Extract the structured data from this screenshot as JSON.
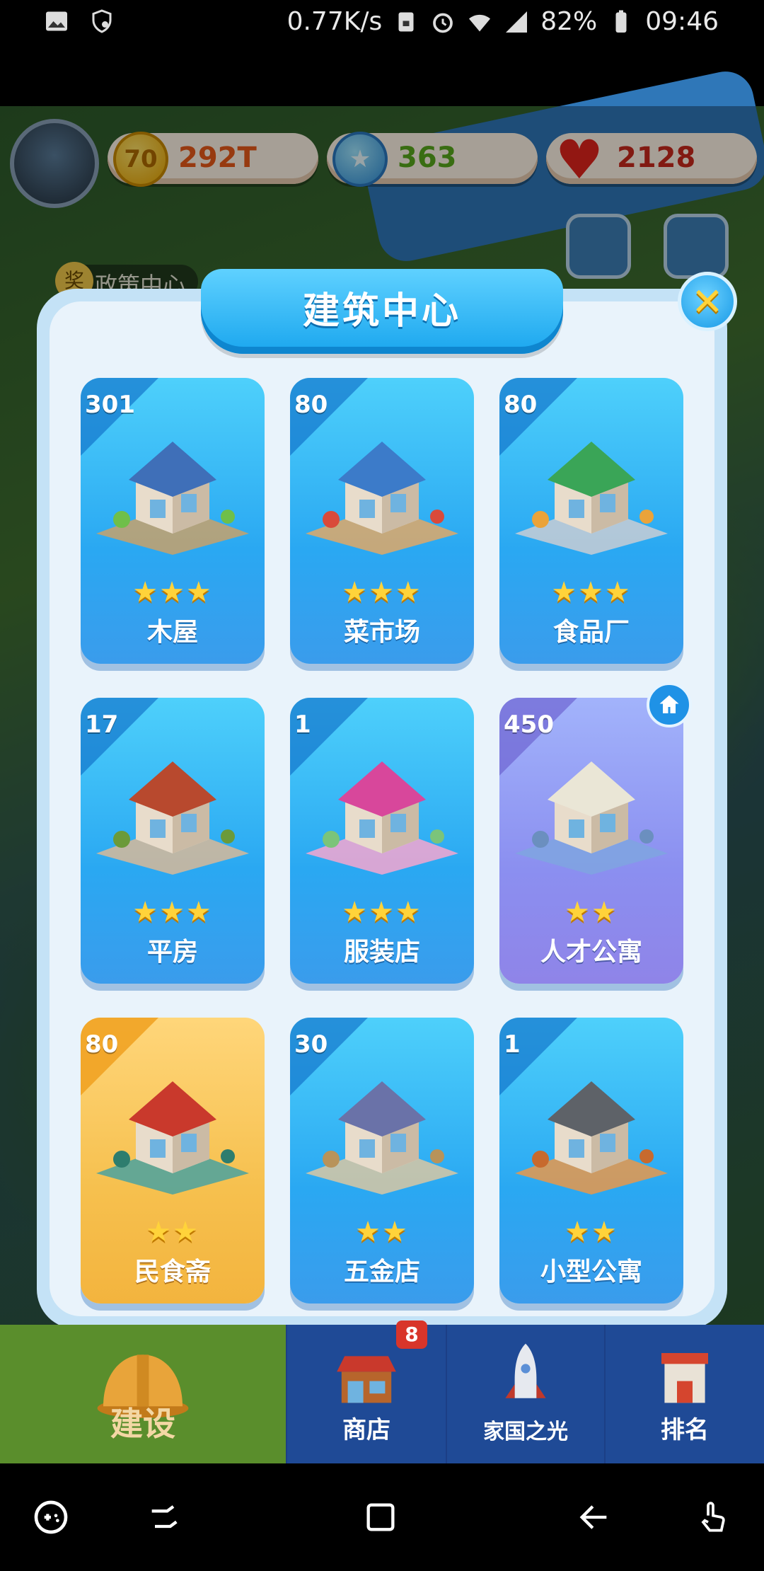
{
  "status_bar": {
    "network_speed": "0.77K/s",
    "battery": "82%",
    "time": "09:46",
    "signal": "4G",
    "left_icons": [
      "image-icon",
      "vpn-key-icon"
    ],
    "right_icons": [
      "sim-lock-icon",
      "alarm-icon",
      "wifi-icon",
      "signal-icon",
      "battery-icon"
    ]
  },
  "hud": {
    "coins": "292T",
    "coin_icon_text": "70",
    "stars": "363",
    "hearts": "2128",
    "map_label": "政策中心",
    "map_badge": "奖"
  },
  "modal": {
    "title": "建筑中心",
    "close_icon": "close-icon"
  },
  "buildings": [
    {
      "count": "301",
      "stars": "★★★",
      "name": "木屋",
      "theme": "blue"
    },
    {
      "count": "80",
      "stars": "★★★",
      "name": "菜市场",
      "theme": "blue"
    },
    {
      "count": "80",
      "stars": "★★★",
      "name": "食品厂",
      "theme": "blue"
    },
    {
      "count": "17",
      "stars": "★★★",
      "name": "平房",
      "theme": "blue"
    },
    {
      "count": "1",
      "stars": "★★★",
      "name": "服装店",
      "theme": "blue"
    },
    {
      "count": "450",
      "stars": "★★",
      "name": "人才公寓",
      "theme": "purple"
    },
    {
      "count": "80",
      "stars": "★★",
      "name": "民食斋",
      "theme": "gold"
    },
    {
      "count": "30",
      "stars": "★★",
      "name": "五金店",
      "theme": "blue"
    },
    {
      "count": "1",
      "stars": "★★",
      "name": "小型公寓",
      "theme": "blue"
    }
  ],
  "bottom_nav": {
    "build": "建设",
    "shop": "商店",
    "shop_badge": "8",
    "country": "家国之光",
    "rank": "排名"
  },
  "colors": {
    "card_blue": "#2aa8f2",
    "card_purple": "#8b8ff0",
    "card_gold": "#f6c04e",
    "star": "#ffd33a",
    "nav_blue": "#1f4a96",
    "nav_green": "#5a8e2c"
  }
}
